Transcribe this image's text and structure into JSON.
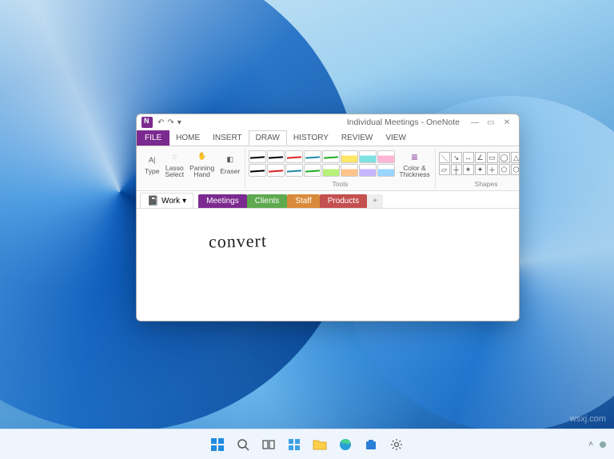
{
  "desktop": {
    "watermark": "wsxj.com"
  },
  "taskbar": {
    "icons": [
      "start",
      "search",
      "taskview",
      "widgets",
      "explorer",
      "edge",
      "store",
      "settings"
    ]
  },
  "window": {
    "titleText": "Individual Meetings - OneNote",
    "tabs": {
      "file": "FILE",
      "home": "HOME",
      "insert": "INSERT",
      "draw": "DRAW",
      "history": "HISTORY",
      "review": "REVIEW",
      "view": "VIEW",
      "active": "DRAW"
    },
    "ribbon": {
      "type": "Type",
      "lasso": "Lasso\nSelect",
      "pan": "Panning\nHand",
      "eraser": "Eraser",
      "toolsLabel": "Tools",
      "colorThickness": "Color &\nThickness",
      "shapesLabel": "Shapes"
    },
    "notebook": {
      "picker": "Work",
      "sections": [
        {
          "label": "Meetings",
          "color": "sel"
        },
        {
          "label": "Clients",
          "color": "green"
        },
        {
          "label": "Staff",
          "color": "orange"
        },
        {
          "label": "Products",
          "color": "red"
        }
      ],
      "addTab": "+"
    },
    "ink": "convert"
  }
}
